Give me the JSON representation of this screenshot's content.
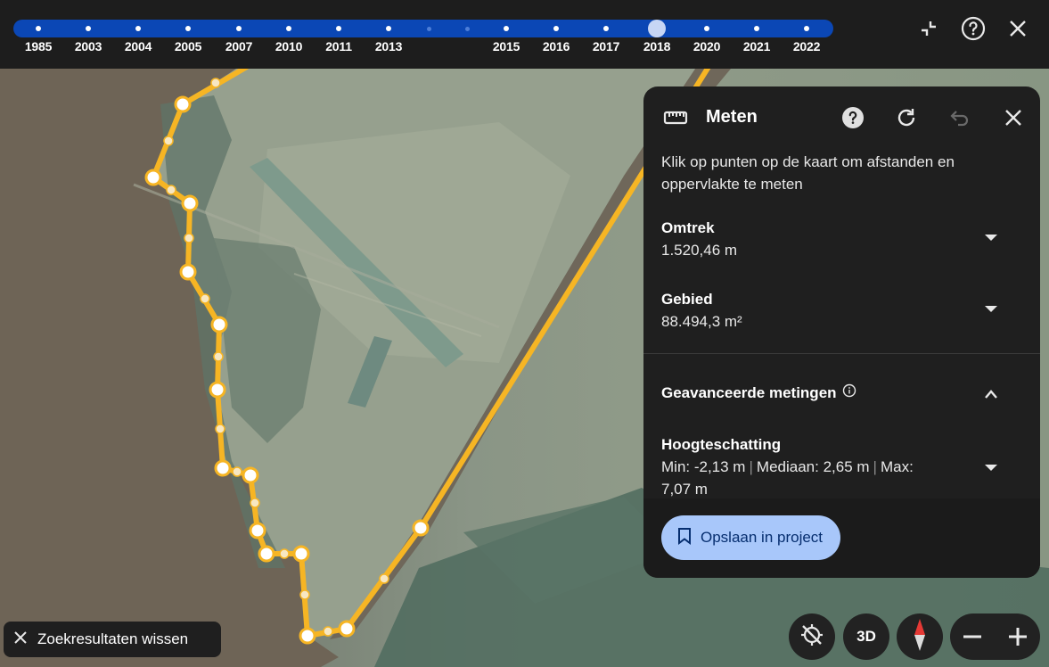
{
  "timeline": {
    "years": [
      "1985",
      "2003",
      "2004",
      "2005",
      "2007",
      "2010",
      "2011",
      "2013",
      "2015",
      "2016",
      "2017",
      "2018",
      "2020",
      "2021",
      "2022"
    ],
    "selected_year": "2018"
  },
  "top_controls": {
    "collapse_icon": "collapse-icon",
    "help_icon": "help-circle-icon",
    "close_icon": "close-icon"
  },
  "measure_panel": {
    "title": "Meten",
    "description": "Klik op punten op de kaart om afstanden en oppervlakte te meten",
    "perimeter": {
      "label": "Omtrek",
      "value": "1.520,46 m"
    },
    "area": {
      "label": "Gebied",
      "value": "88.494,3 m²"
    },
    "advanced": {
      "label": "Geavanceerde metingen"
    },
    "height": {
      "label": "Hoogteschatting",
      "min": "Min: -2,13 m",
      "median": "Mediaan: 2,65 m",
      "max_line1": "Max:",
      "max_line2": "7,07 m",
      "separator": "|"
    },
    "save_label": "Opslaan in project"
  },
  "clear_chip": {
    "label": "Zoekresultaten wissen"
  },
  "map_controls": {
    "three_d_label": "3D",
    "zoom_out": "−",
    "zoom_in": "+"
  },
  "colors": {
    "measure_line": "#f6b524",
    "timeline": "#0b47b5",
    "save_button": "#a8c7fa"
  }
}
